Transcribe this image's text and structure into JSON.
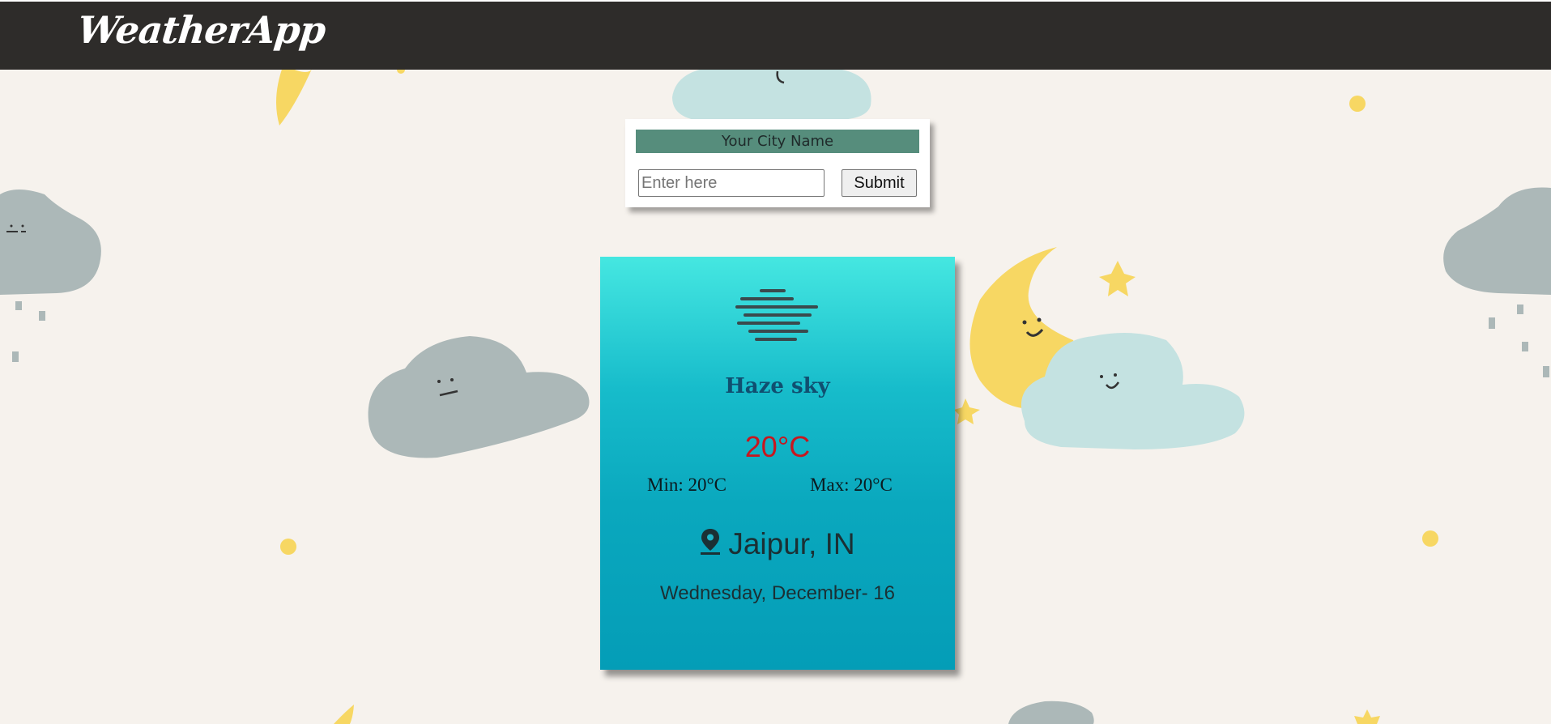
{
  "navbar": {
    "brand": "WeatherApp"
  },
  "search": {
    "heading": "Your City Name",
    "placeholder": "Enter here",
    "value": "",
    "submit_label": "Submit"
  },
  "weather": {
    "icon": "haze-icon",
    "condition": "Haze sky",
    "temperature": "20°C",
    "min": "Min: 20°C",
    "max": "Max: 20°C",
    "location_icon": "map-pin-icon",
    "location": "Jaipur, IN",
    "date": "Wednesday, December- 16"
  },
  "colors": {
    "navbar_bg": "#2e2c2a",
    "page_bg": "#f6f2ed",
    "search_heading_bg": "#568d7c",
    "card_gradient_top": "#45e7e1",
    "card_gradient_bottom": "#049db7",
    "condition_text": "#104f70",
    "temperature_text": "#c8161e"
  },
  "decorations": [
    "cloud-icon",
    "moon-icon",
    "star-icon",
    "dot-icon",
    "raindrop-icon"
  ]
}
